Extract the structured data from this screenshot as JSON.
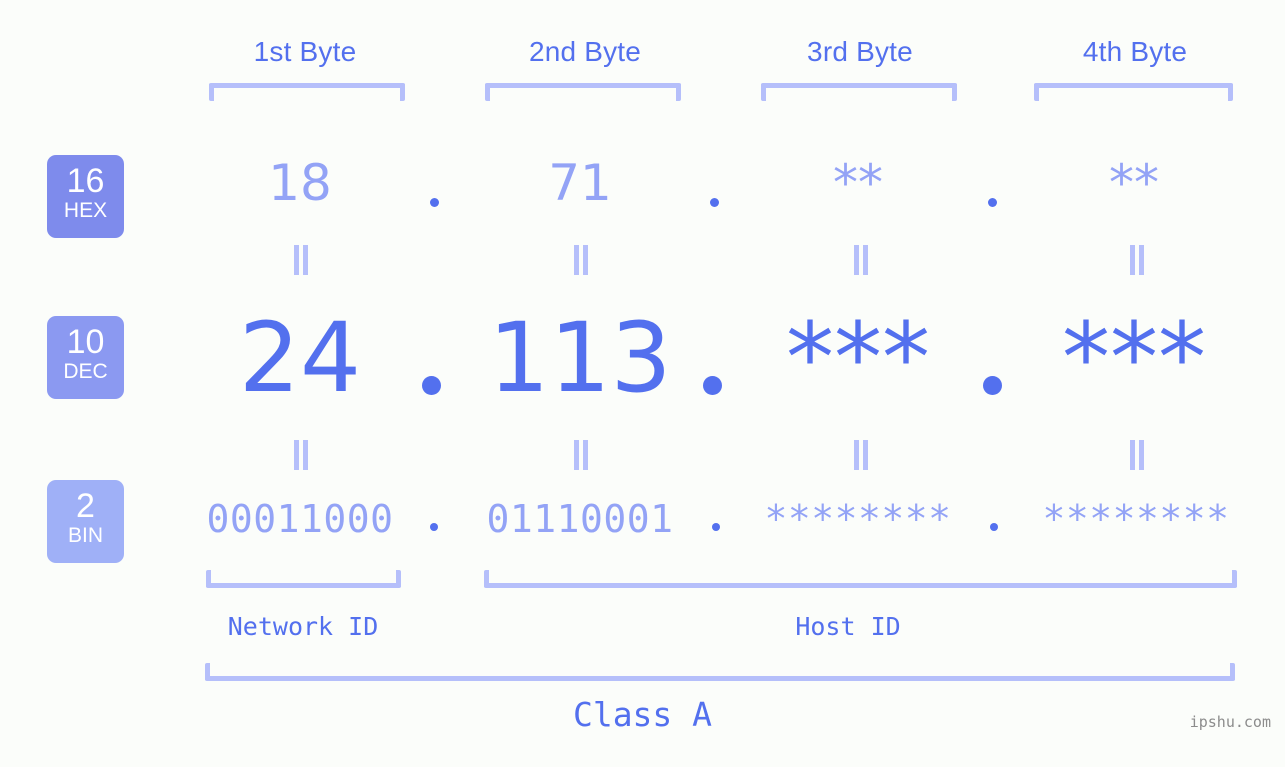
{
  "meta": {
    "background_color": "#fbfdfa",
    "accent_strong": "#5370ee",
    "accent_light": "#93a3f6",
    "bracket_color": "#b5bffa"
  },
  "byte_headers": [
    {
      "label": "1st Byte"
    },
    {
      "label": "2nd Byte"
    },
    {
      "label": "3rd Byte"
    },
    {
      "label": "4th Byte"
    }
  ],
  "rows": [
    {
      "id": "hex",
      "badge_number": "16",
      "badge_base": "HEX",
      "badge_color": "#7e8bec",
      "values": [
        "18",
        "71",
        "**",
        "**"
      ],
      "separator": "."
    },
    {
      "id": "dec",
      "badge_number": "10",
      "badge_base": "DEC",
      "badge_color": "#8b99f1",
      "values": [
        "24",
        "113",
        "***",
        "***"
      ],
      "separator": "."
    },
    {
      "id": "bin",
      "badge_number": "2",
      "badge_base": "BIN",
      "badge_color": "#9fb0f7",
      "values": [
        "00011000",
        "01110001",
        "********",
        "********"
      ],
      "separator": "."
    }
  ],
  "equals_signs": [
    "=",
    "=",
    "=",
    "=",
    "=",
    "=",
    "=",
    "="
  ],
  "id_labels": {
    "network": "Network ID",
    "host": "Host ID"
  },
  "class_label": "Class A",
  "watermark": "ipshu.com"
}
